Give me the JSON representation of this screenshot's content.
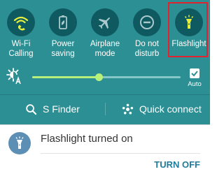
{
  "quick_settings": {
    "tiles": [
      {
        "label": "Wi-Fi\nCalling",
        "icon": "wifi-calling-icon"
      },
      {
        "label": "Power\nsaving",
        "icon": "power-saving-icon"
      },
      {
        "label": "Airplane\nmode",
        "icon": "airplane-icon"
      },
      {
        "label": "Do not\ndisturb",
        "icon": "do-not-disturb-icon"
      },
      {
        "label": "Flashlight",
        "icon": "flashlight-icon",
        "active": true
      }
    ]
  },
  "brightness": {
    "level": 0.45,
    "auto_label": "Auto",
    "auto_checked": true
  },
  "bottom_bar": {
    "sfinder_label": "S Finder",
    "quick_connect_label": "Quick connect"
  },
  "notification": {
    "title": "Flashlight turned on",
    "action_label": "TURN OFF",
    "icon": "flashlight-icon"
  },
  "colors": {
    "panel_bg": "#2c8f93",
    "tile_circle": "#0f5961",
    "active_icon": "#e6f03c",
    "slider_active": "#b8f07c",
    "highlight": "#e0232f",
    "action_text": "#1f7d9b"
  }
}
